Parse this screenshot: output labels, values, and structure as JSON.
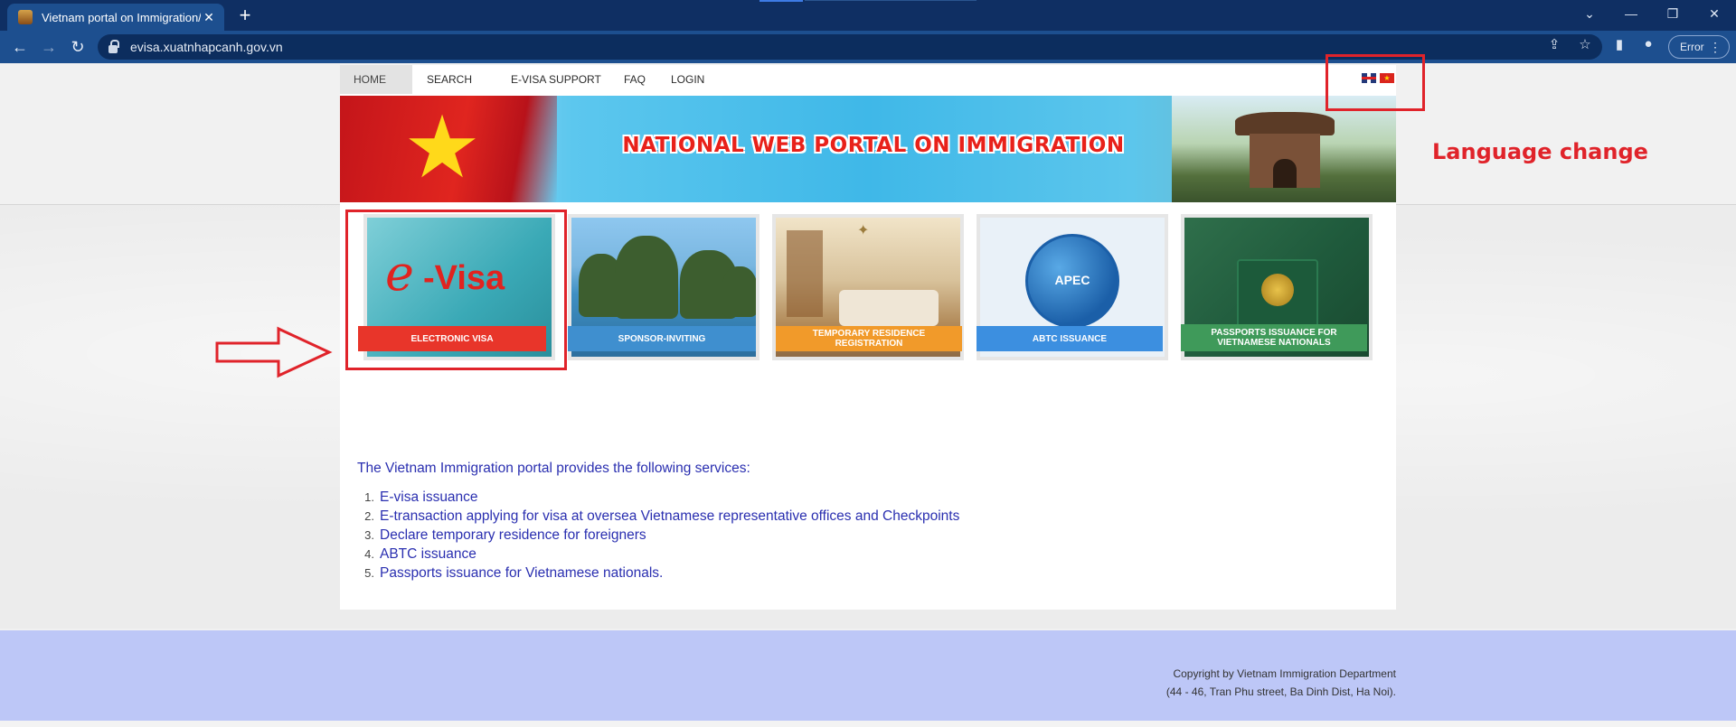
{
  "browser": {
    "tab_title": "Vietnam portal on Immigration/\\",
    "url": "evisa.xuatnhapcanh.gov.vn",
    "error_label": "Error"
  },
  "menu": {
    "items": [
      "HOME",
      "SEARCH",
      "E-VISA SUPPORT",
      "FAQ",
      "LOGIN"
    ]
  },
  "banner": {
    "title": "NATIONAL WEB PORTAL ON IMMIGRATION"
  },
  "cards": [
    {
      "label": "ELECTRONIC VISA",
      "image_text": "e-Visa",
      "color": "#e8352a"
    },
    {
      "label": "SPONSOR-INVITING",
      "color": "#3f8fcf"
    },
    {
      "label": "TEMPORARY RESIDENCE REGISTRATION",
      "color": "#f19a2a"
    },
    {
      "label": "ABTC ISSUANCE",
      "image_text": "APEC",
      "color": "#3c8fe0"
    },
    {
      "label": "PASSPORTS ISSUANCE FOR VIETNAMESE NATIONALS",
      "color": "#3f9a5a"
    }
  ],
  "annotation": {
    "text": "Language change"
  },
  "services": {
    "intro": "The Vietnam Immigration portal provides the following services:",
    "items": [
      {
        "num": "1.",
        "text": "E-visa issuance"
      },
      {
        "num": "2.",
        "text": "E-transaction applying for visa at oversea Vietnamese representative offices and Checkpoints"
      },
      {
        "num": "3.",
        "text": "Declare temporary residence for foreigners"
      },
      {
        "num": "4.",
        "text": "ABTC issuance"
      },
      {
        "num": "5.",
        "text": "Passports issuance for Vietnamese nationals."
      }
    ]
  },
  "footer": {
    "line1": "Copyright by Vietnam Immigration Department",
    "line2": "(44 - 46, Tran Phu street, Ba Dinh Dist, Ha Noi)."
  }
}
